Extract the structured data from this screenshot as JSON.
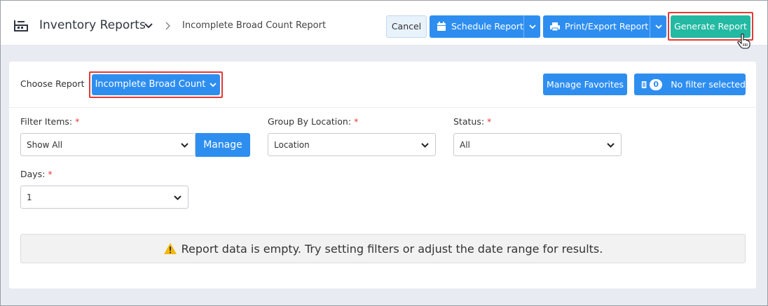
{
  "header": {
    "app_title": "Inventory Reports",
    "app_icon": "factory-icon",
    "breadcrumb": "Incomplete Broad Count Report",
    "buttons": {
      "cancel": "Cancel",
      "schedule": "Schedule Report",
      "print_export": "Print/Export Report",
      "generate": "Generate Report"
    }
  },
  "report_bar": {
    "choose_label": "Choose Report",
    "selected_report": "Incomplete Broad Count",
    "manage_favorites": "Manage Favorites",
    "filter_count": "0",
    "filter_status": "No filter selected"
  },
  "filters": {
    "filter_items": {
      "label": "Filter Items:",
      "required_mark": "*",
      "value": "Show All",
      "manage_label": "Manage"
    },
    "group_by_location": {
      "label": "Group By Location:",
      "required_mark": "*",
      "value": "Location"
    },
    "status": {
      "label": "Status:",
      "required_mark": "*",
      "value": "All"
    },
    "days": {
      "label": "Days:",
      "required_mark": "*",
      "value": "1"
    }
  },
  "alert": {
    "message": "Report data is empty. Try setting filters or adjust the date range for results."
  },
  "colors": {
    "primary": "#2e8ef0",
    "generate": "#23b9a2",
    "highlight": "#e53935",
    "background": "#e9ebf2",
    "warning": "#f5b800"
  }
}
